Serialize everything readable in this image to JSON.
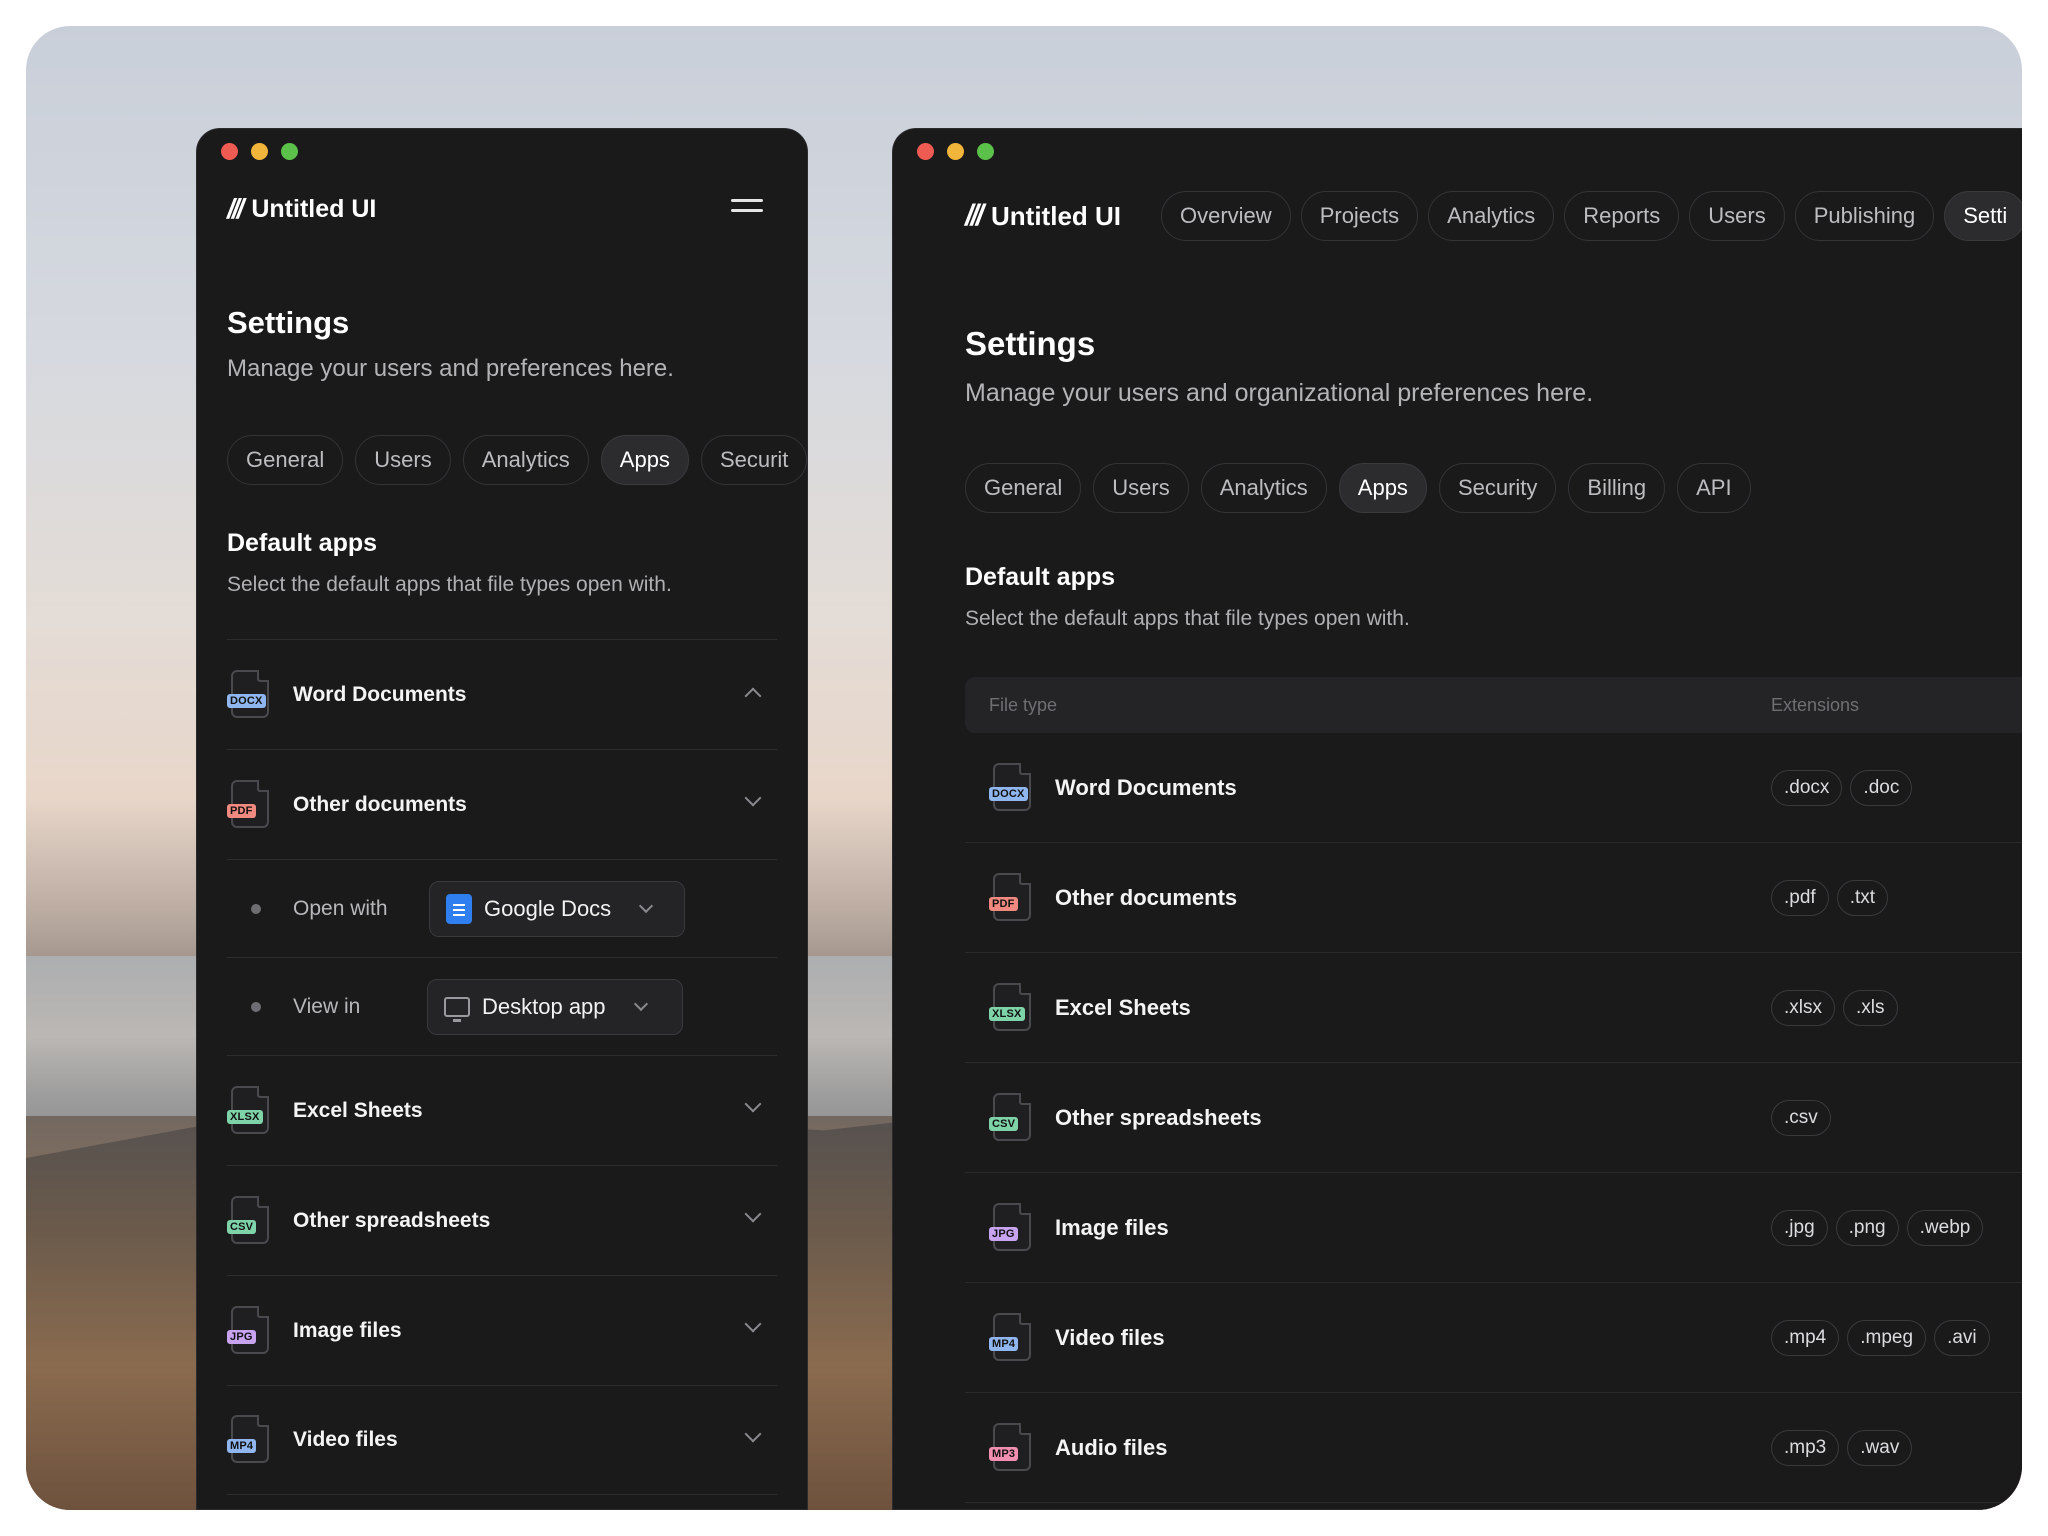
{
  "brand": {
    "name": "Untitled UI"
  },
  "colors": {
    "docx": "#8fb6ee",
    "pdf": "#f08a80",
    "xlsx": "#7fd3a8",
    "csv": "#7fd3a8",
    "jpg": "#c8a3f0",
    "mp4": "#8fb6ee",
    "mp3": "#f08fb0"
  },
  "left": {
    "title": "Settings",
    "subtitle": "Manage your users and preferences here.",
    "tabs": [
      "General",
      "Users",
      "Analytics",
      "Apps",
      "Securit"
    ],
    "active_tab": "Apps",
    "section_title": "Default apps",
    "section_sub": "Select the default apps that file types open with.",
    "items": [
      {
        "tag": "DOCX",
        "label": "Word Documents"
      },
      {
        "tag": "PDF",
        "label": "Other documents"
      },
      {
        "tag": "XLSX",
        "label": "Excel Sheets"
      },
      {
        "tag": "CSV",
        "label": "Other spreadsheets"
      },
      {
        "tag": "JPG",
        "label": "Image files"
      },
      {
        "tag": "MP4",
        "label": "Video files"
      }
    ],
    "open_with": {
      "label": "Open with",
      "value": "Google Docs",
      "icon": "google-docs-icon"
    },
    "view_in": {
      "label": "View in",
      "value": "Desktop app",
      "icon": "monitor-icon"
    }
  },
  "right": {
    "nav": [
      "Overview",
      "Projects",
      "Analytics",
      "Reports",
      "Users",
      "Publishing",
      "Setti"
    ],
    "title": "Settings",
    "subtitle": "Manage your users and organizational preferences here.",
    "tabs": [
      "General",
      "Users",
      "Analytics",
      "Apps",
      "Security",
      "Billing",
      "API"
    ],
    "active_tab": "Apps",
    "section_title": "Default apps",
    "section_sub": "Select the default apps that file types open with.",
    "table": {
      "headers": [
        "File type",
        "Extensions"
      ],
      "rows": [
        {
          "tag": "DOCX",
          "name": "Word Documents",
          "exts": [
            ".docx",
            ".doc"
          ]
        },
        {
          "tag": "PDF",
          "name": "Other documents",
          "exts": [
            ".pdf",
            ".txt"
          ]
        },
        {
          "tag": "XLSX",
          "name": "Excel Sheets",
          "exts": [
            ".xlsx",
            ".xls"
          ]
        },
        {
          "tag": "CSV",
          "name": "Other spreadsheets",
          "exts": [
            ".csv"
          ]
        },
        {
          "tag": "JPG",
          "name": "Image files",
          "exts": [
            ".jpg",
            ".png",
            ".webp"
          ]
        },
        {
          "tag": "MP4",
          "name": "Video files",
          "exts": [
            ".mp4",
            ".mpeg",
            ".avi"
          ]
        },
        {
          "tag": "MP3",
          "name": "Audio files",
          "exts": [
            ".mp3",
            ".wav"
          ]
        }
      ]
    }
  }
}
